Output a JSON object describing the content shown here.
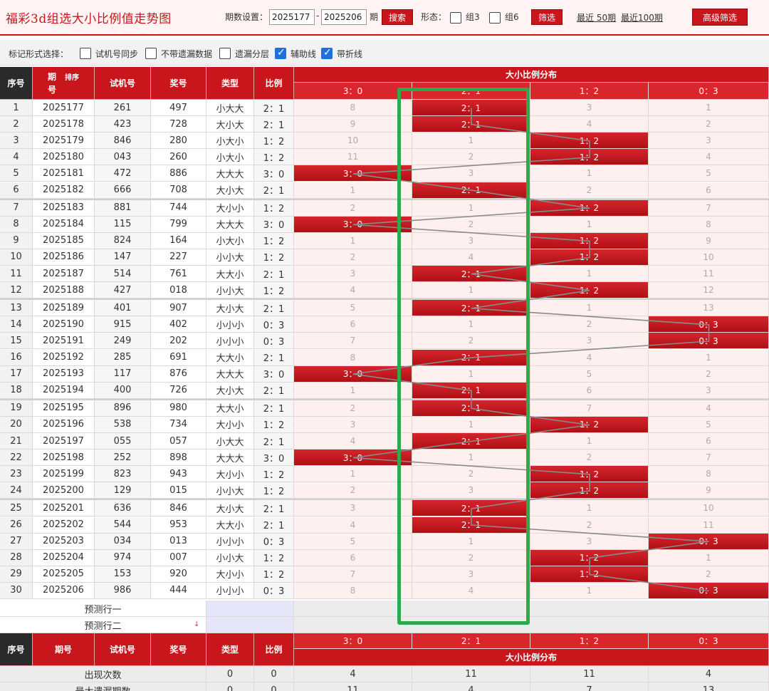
{
  "header": {
    "title": "福彩3d组选大小比例值走势图",
    "period_label": "期数设置：",
    "period_start": "2025177",
    "dash": "-",
    "period_end": "2025206",
    "period_unit": "期",
    "search_label": "搜索",
    "form_label": "形态：",
    "group3_label": "组3",
    "group6_label": "组6",
    "filter_label": "筛选",
    "recent50_label": "最近 50期",
    "recent100_label": "最近100期",
    "advanced_label": "高级筛选"
  },
  "markbar": {
    "label": "标记形式选择：",
    "options": [
      {
        "label": "试机号同步",
        "checked": false
      },
      {
        "label": "不带遗漏数据",
        "checked": false
      },
      {
        "label": "遗漏分层",
        "checked": false
      },
      {
        "label": "辅助线",
        "checked": true
      },
      {
        "label": "带折线",
        "checked": true
      }
    ]
  },
  "table": {
    "headers": {
      "seq": "序号",
      "period": "期号",
      "sort": "排序",
      "trial": "试机号",
      "prize": "奖号",
      "type": "类型",
      "ratio": "比例",
      "dist_title": "大小比例分布"
    },
    "ratio_columns": [
      "3：0",
      "2：1",
      "1：2",
      "0：3"
    ],
    "rows": [
      {
        "seq": "1",
        "period": "2025177",
        "trial": "261",
        "prize": "497",
        "type": "小大大",
        "ratio": "2：1",
        "dist": [
          "8",
          "2：1",
          "3",
          "1"
        ],
        "hit": 1
      },
      {
        "seq": "2",
        "period": "2025178",
        "trial": "423",
        "prize": "728",
        "type": "大小大",
        "ratio": "2：1",
        "dist": [
          "9",
          "2：1",
          "4",
          "2"
        ],
        "hit": 1
      },
      {
        "seq": "3",
        "period": "2025179",
        "trial": "846",
        "prize": "280",
        "type": "小大小",
        "ratio": "1：2",
        "dist": [
          "10",
          "1",
          "1：2",
          "3"
        ],
        "hit": 2
      },
      {
        "seq": "4",
        "period": "2025180",
        "trial": "043",
        "prize": "260",
        "type": "小大小",
        "ratio": "1：2",
        "dist": [
          "11",
          "2",
          "1：2",
          "4"
        ],
        "hit": 2
      },
      {
        "seq": "5",
        "period": "2025181",
        "trial": "472",
        "prize": "886",
        "type": "大大大",
        "ratio": "3：0",
        "dist": [
          "3：0",
          "3",
          "1",
          "5"
        ],
        "hit": 0
      },
      {
        "seq": "6",
        "period": "2025182",
        "trial": "666",
        "prize": "708",
        "type": "大小大",
        "ratio": "2：1",
        "dist": [
          "1",
          "2：1",
          "2",
          "6"
        ],
        "hit": 1
      },
      {
        "seq": "7",
        "period": "2025183",
        "trial": "881",
        "prize": "744",
        "type": "大小小",
        "ratio": "1：2",
        "dist": [
          "2",
          "1",
          "1：2",
          "7"
        ],
        "hit": 2
      },
      {
        "seq": "8",
        "period": "2025184",
        "trial": "115",
        "prize": "799",
        "type": "大大大",
        "ratio": "3：0",
        "dist": [
          "3：0",
          "2",
          "1",
          "8"
        ],
        "hit": 0
      },
      {
        "seq": "9",
        "period": "2025185",
        "trial": "824",
        "prize": "164",
        "type": "小大小",
        "ratio": "1：2",
        "dist": [
          "1",
          "3",
          "1：2",
          "9"
        ],
        "hit": 2
      },
      {
        "seq": "10",
        "period": "2025186",
        "trial": "147",
        "prize": "227",
        "type": "小小大",
        "ratio": "1：2",
        "dist": [
          "2",
          "4",
          "1：2",
          "10"
        ],
        "hit": 2
      },
      {
        "seq": "11",
        "period": "2025187",
        "trial": "514",
        "prize": "761",
        "type": "大大小",
        "ratio": "2：1",
        "dist": [
          "3",
          "2：1",
          "1",
          "11"
        ],
        "hit": 1
      },
      {
        "seq": "12",
        "period": "2025188",
        "trial": "427",
        "prize": "018",
        "type": "小小大",
        "ratio": "1：2",
        "dist": [
          "4",
          "1",
          "1：2",
          "12"
        ],
        "hit": 2
      },
      {
        "seq": "13",
        "period": "2025189",
        "trial": "401",
        "prize": "907",
        "type": "大小大",
        "ratio": "2：1",
        "dist": [
          "5",
          "2：1",
          "1",
          "13"
        ],
        "hit": 1
      },
      {
        "seq": "14",
        "period": "2025190",
        "trial": "915",
        "prize": "402",
        "type": "小小小",
        "ratio": "0：3",
        "dist": [
          "6",
          "1",
          "2",
          "0：3"
        ],
        "hit": 3
      },
      {
        "seq": "15",
        "period": "2025191",
        "trial": "249",
        "prize": "202",
        "type": "小小小",
        "ratio": "0：3",
        "dist": [
          "7",
          "2",
          "3",
          "0：3"
        ],
        "hit": 3
      },
      {
        "seq": "16",
        "period": "2025192",
        "trial": "285",
        "prize": "691",
        "type": "大大小",
        "ratio": "2：1",
        "dist": [
          "8",
          "2：1",
          "4",
          "1"
        ],
        "hit": 1
      },
      {
        "seq": "17",
        "period": "2025193",
        "trial": "117",
        "prize": "876",
        "type": "大大大",
        "ratio": "3：0",
        "dist": [
          "3：0",
          "1",
          "5",
          "2"
        ],
        "hit": 0
      },
      {
        "seq": "18",
        "period": "2025194",
        "trial": "400",
        "prize": "726",
        "type": "大小大",
        "ratio": "2：1",
        "dist": [
          "1",
          "2：1",
          "6",
          "3"
        ],
        "hit": 1
      },
      {
        "seq": "19",
        "period": "2025195",
        "trial": "896",
        "prize": "980",
        "type": "大大小",
        "ratio": "2：1",
        "dist": [
          "2",
          "2：1",
          "7",
          "4"
        ],
        "hit": 1
      },
      {
        "seq": "20",
        "period": "2025196",
        "trial": "538",
        "prize": "734",
        "type": "大小小",
        "ratio": "1：2",
        "dist": [
          "3",
          "1",
          "1：2",
          "5"
        ],
        "hit": 2
      },
      {
        "seq": "21",
        "period": "2025197",
        "trial": "055",
        "prize": "057",
        "type": "小大大",
        "ratio": "2：1",
        "dist": [
          "4",
          "2：1",
          "1",
          "6"
        ],
        "hit": 1
      },
      {
        "seq": "22",
        "period": "2025198",
        "trial": "252",
        "prize": "898",
        "type": "大大大",
        "ratio": "3：0",
        "dist": [
          "3：0",
          "1",
          "2",
          "7"
        ],
        "hit": 0
      },
      {
        "seq": "23",
        "period": "2025199",
        "trial": "823",
        "prize": "943",
        "type": "大小小",
        "ratio": "1：2",
        "dist": [
          "1",
          "2",
          "1：2",
          "8"
        ],
        "hit": 2
      },
      {
        "seq": "24",
        "period": "2025200",
        "trial": "129",
        "prize": "015",
        "type": "小小大",
        "ratio": "1：2",
        "dist": [
          "2",
          "3",
          "1：2",
          "9"
        ],
        "hit": 2
      },
      {
        "seq": "25",
        "period": "2025201",
        "trial": "636",
        "prize": "846",
        "type": "大小大",
        "ratio": "2：1",
        "dist": [
          "3",
          "2：1",
          "1",
          "10"
        ],
        "hit": 1
      },
      {
        "seq": "26",
        "period": "2025202",
        "trial": "544",
        "prize": "953",
        "type": "大大小",
        "ratio": "2：1",
        "dist": [
          "4",
          "2：1",
          "2",
          "11"
        ],
        "hit": 1
      },
      {
        "seq": "27",
        "period": "2025203",
        "trial": "034",
        "prize": "013",
        "type": "小小小",
        "ratio": "0：3",
        "dist": [
          "5",
          "1",
          "3",
          "0：3"
        ],
        "hit": 3
      },
      {
        "seq": "28",
        "period": "2025204",
        "trial": "974",
        "prize": "007",
        "type": "小小大",
        "ratio": "1：2",
        "dist": [
          "6",
          "2",
          "1：2",
          "1"
        ],
        "hit": 2
      },
      {
        "seq": "29",
        "period": "2025205",
        "trial": "153",
        "prize": "920",
        "type": "大小小",
        "ratio": "1：2",
        "dist": [
          "7",
          "3",
          "1：2",
          "2"
        ],
        "hit": 2
      },
      {
        "seq": "30",
        "period": "2025206",
        "trial": "986",
        "prize": "444",
        "type": "小小小",
        "ratio": "0：3",
        "dist": [
          "8",
          "4",
          "1",
          "0：3"
        ],
        "hit": 3
      }
    ],
    "predict_rows": [
      "预测行一",
      "预测行二"
    ],
    "stats": [
      {
        "label": "出现次数",
        "type": "0",
        "ratio": "0",
        "values": [
          "4",
          "11",
          "11",
          "4"
        ]
      },
      {
        "label": "最大遗漏期数",
        "type": "0",
        "ratio": "0",
        "values": [
          "11",
          "4",
          "7",
          "13"
        ]
      }
    ]
  },
  "colors": {
    "brand_red": "#c9151c",
    "highlight_green": "#2fa94a",
    "checkbox_blue": "#1f6fe0"
  }
}
